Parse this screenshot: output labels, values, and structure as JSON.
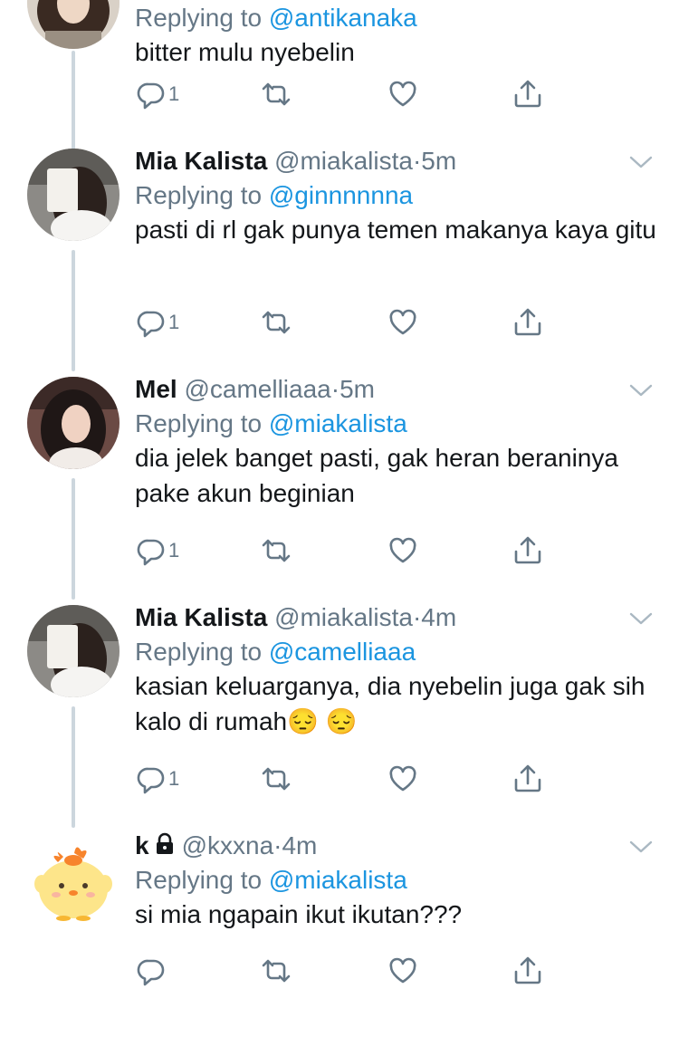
{
  "tweets": [
    {
      "name": "",
      "handle": "",
      "time": "",
      "replying_label": "Replying to",
      "replying_to": "@antikanaka",
      "text": "bitter mulu nyebelin",
      "reply_count": "1",
      "locked": false
    },
    {
      "name": "Mia Kalista",
      "handle": "@miakalista",
      "time": "5m",
      "replying_label": "Replying to",
      "replying_to": "@ginnnnnna",
      "text": "pasti di rl gak punya temen makanya kaya gitu",
      "reply_count": "1",
      "locked": false
    },
    {
      "name": "Mel",
      "handle": "@camelliaaa",
      "time": "5m",
      "replying_label": "Replying to",
      "replying_to": "@miakalista",
      "text": "dia jelek banget pasti, gak heran beraninya pake akun beginian",
      "reply_count": "1",
      "locked": false
    },
    {
      "name": "Mia Kalista",
      "handle": "@miakalista",
      "time": "4m",
      "replying_label": "Replying to",
      "replying_to": "@camelliaaa",
      "text": "kasian keluarganya, dia nyebelin juga gak sih kalo di rumah😔 😔",
      "reply_count": "1",
      "locked": false
    },
    {
      "name": "k",
      "handle": "@kxxna",
      "time": "4m",
      "replying_label": "Replying to",
      "replying_to": "@miakalista",
      "text": "si mia ngapain ikut ikutan???",
      "reply_count": "",
      "locked": true
    }
  ],
  "separator": "·",
  "colors": {
    "link": "#1b95e0",
    "muted": "#657786",
    "text": "#14171a",
    "thread_line": "#ccd6dd"
  },
  "icons": {
    "reply": "reply-icon",
    "retweet": "retweet-icon",
    "like": "heart-icon",
    "share": "share-icon",
    "menu": "chevron-down-icon",
    "lock": "lock-icon"
  }
}
